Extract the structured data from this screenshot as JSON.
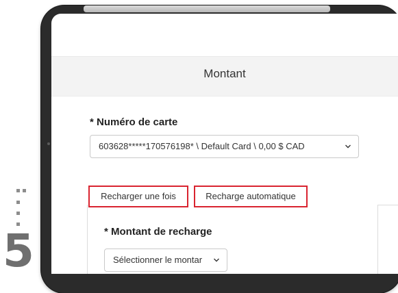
{
  "step": {
    "number": "5"
  },
  "screen": {
    "section_title": "Montant",
    "card": {
      "label": "* Numéro de carte",
      "selected_value": "603628*****170576198* \\ Default Card \\ 0,00 $ CAD"
    },
    "tabs": [
      {
        "label": "Recharger une fois"
      },
      {
        "label": "Recharge automatique"
      }
    ],
    "amount": {
      "label": "* Montant de recharge",
      "selected_value": "Sélectionner le montar"
    }
  },
  "colors": {
    "highlight_border": "#d9232f",
    "header_background": "#f3f3f3",
    "device_frame": "#2b2b2b"
  },
  "icons": {
    "select_chevron": "chevron-down-icon"
  }
}
